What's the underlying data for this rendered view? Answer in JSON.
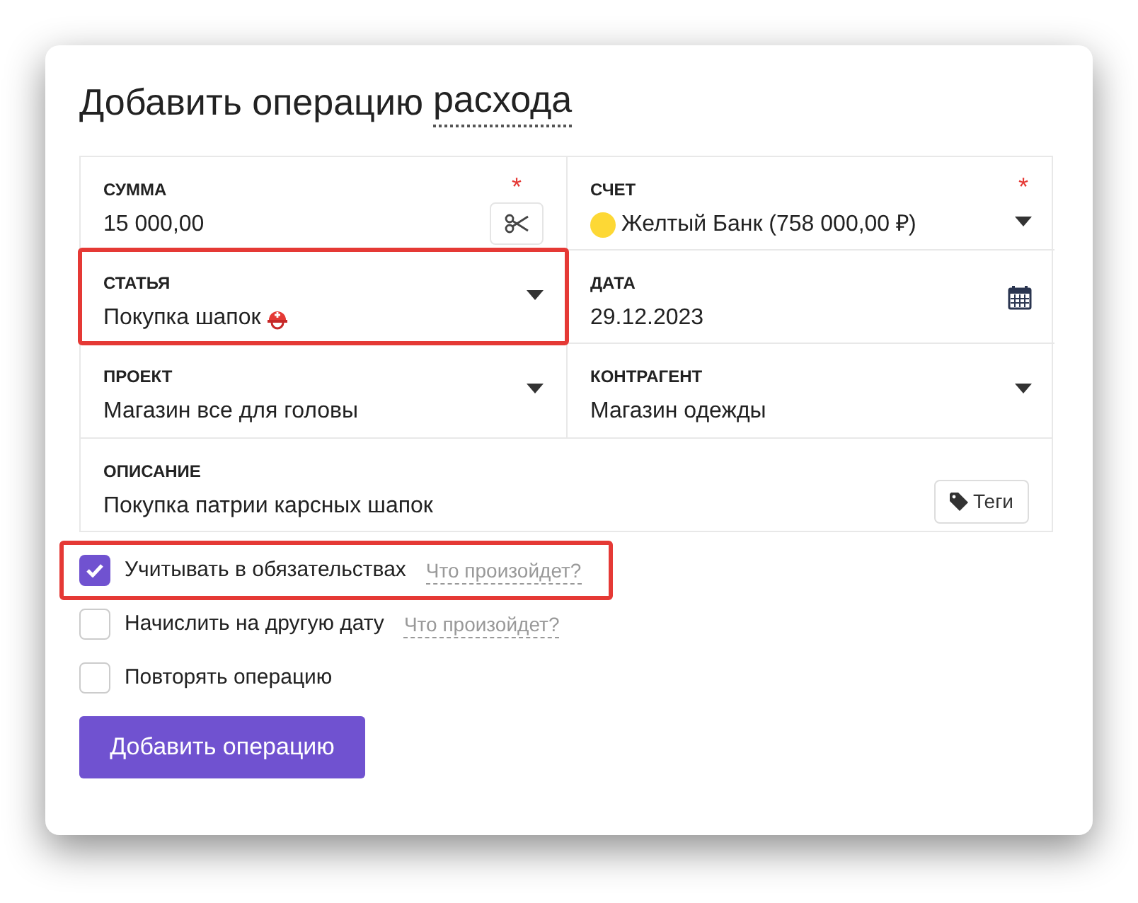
{
  "title": "Добавить операцию",
  "title_type_link": "расхода",
  "required_mark": "*",
  "fields": [
    {
      "kind": "amount",
      "label": "СУММА",
      "value": "15 000,00",
      "required": true,
      "highlighted": false
    },
    {
      "kind": "account",
      "label": "СЧЕТ",
      "value": "Желтый Банк (758 000,00 ₽)",
      "required": true,
      "highlighted": false,
      "color": "#fdd835"
    },
    {
      "kind": "category",
      "label": "СТАТЬЯ",
      "value": "Покупка шапок",
      "required": false,
      "highlighted": true
    },
    {
      "kind": "date",
      "label": "ДАТА",
      "value": "29.12.2023",
      "required": false,
      "highlighted": false
    },
    {
      "kind": "select",
      "label": "ПРОЕКТ",
      "value": "Магазин все для головы",
      "required": false,
      "highlighted": false
    },
    {
      "kind": "select",
      "label": "КОНТРАГЕНТ",
      "value": "Магазин одежды",
      "required": false,
      "highlighted": false
    }
  ],
  "description": {
    "label": "ОПИСАНИЕ",
    "value": "Покупка патрии карсных шапок",
    "tags_button": "Теги"
  },
  "options": [
    {
      "label": "Учитывать в обязательствах",
      "checked": true,
      "hint": "Что произойдет?",
      "highlighted": true
    },
    {
      "label": "Начислить на другую дату",
      "checked": false,
      "hint": "Что произойдет?",
      "highlighted": false
    },
    {
      "label": "Повторять операцию",
      "checked": false,
      "highlighted": false
    }
  ],
  "submit_button": "Добавить операцию"
}
